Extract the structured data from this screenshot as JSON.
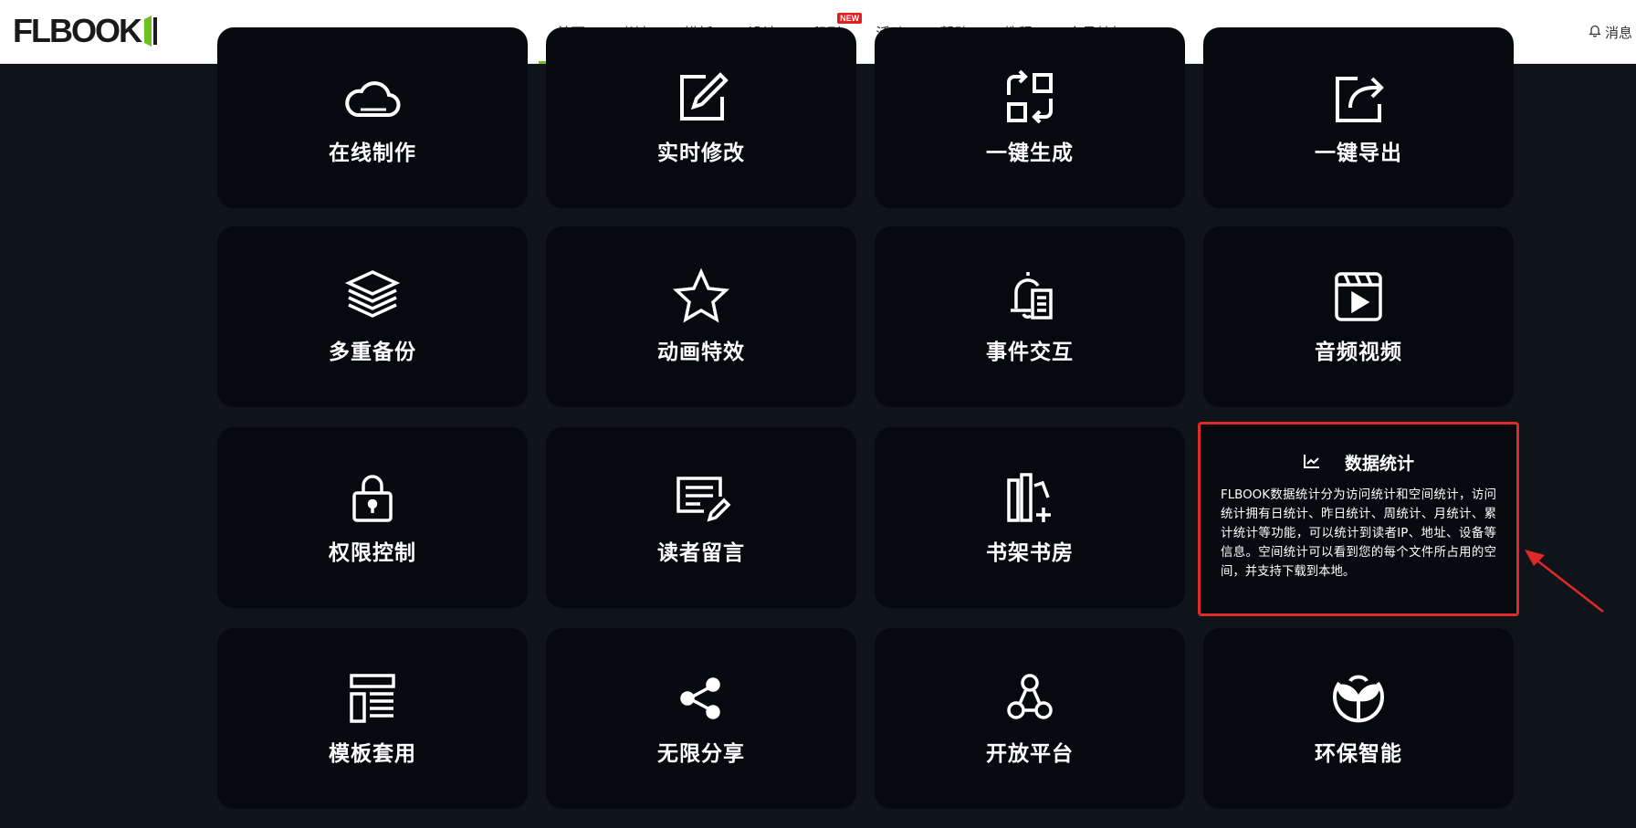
{
  "header": {
    "logo_text": "FLBOOK",
    "nav": [
      {
        "label": "首页",
        "active": true
      },
      {
        "label": "书馆"
      },
      {
        "label": "模板"
      },
      {
        "label": "设计"
      },
      {
        "label": "印刷",
        "badge": "NEW"
      },
      {
        "label": "活动"
      },
      {
        "label": "帮助"
      },
      {
        "label": "教程"
      },
      {
        "label": "会员特权"
      }
    ],
    "messages_label": "消息"
  },
  "features": [
    {
      "title": "在线制作",
      "icon": "cloud-icon"
    },
    {
      "title": "实时修改",
      "icon": "edit-icon"
    },
    {
      "title": "一键生成",
      "icon": "generate-icon"
    },
    {
      "title": "一键导出",
      "icon": "export-icon"
    },
    {
      "title": "多重备份",
      "icon": "layers-icon"
    },
    {
      "title": "动画特效",
      "icon": "star-icon"
    },
    {
      "title": "事件交互",
      "icon": "bell-doc-icon"
    },
    {
      "title": "音频视频",
      "icon": "video-icon"
    },
    {
      "title": "权限控制",
      "icon": "lock-icon"
    },
    {
      "title": "读者留言",
      "icon": "message-edit-icon"
    },
    {
      "title": "书架书房",
      "icon": "bookshelf-icon"
    },
    {
      "title": "数据统计",
      "icon": "chart-icon",
      "description": "FLBOOK数据统计分为访问统计和空间统计，访问统计拥有日统计、昨日统计、周统计、月统计、累计统计等功能，可以统计到读者IP、地址、设备等信息。空间统计可以看到您的每个文件所占用的空间，并支持下载到本地。"
    },
    {
      "title": "模板套用",
      "icon": "template-icon"
    },
    {
      "title": "无限分享",
      "icon": "share-icon"
    },
    {
      "title": "开放平台",
      "icon": "platform-icon"
    },
    {
      "title": "环保智能",
      "icon": "eco-icon"
    }
  ],
  "colors": {
    "background": "#0f141b",
    "card": "#06090e",
    "accent_green": "#6cc01f",
    "highlight_red": "#e02a2a"
  }
}
